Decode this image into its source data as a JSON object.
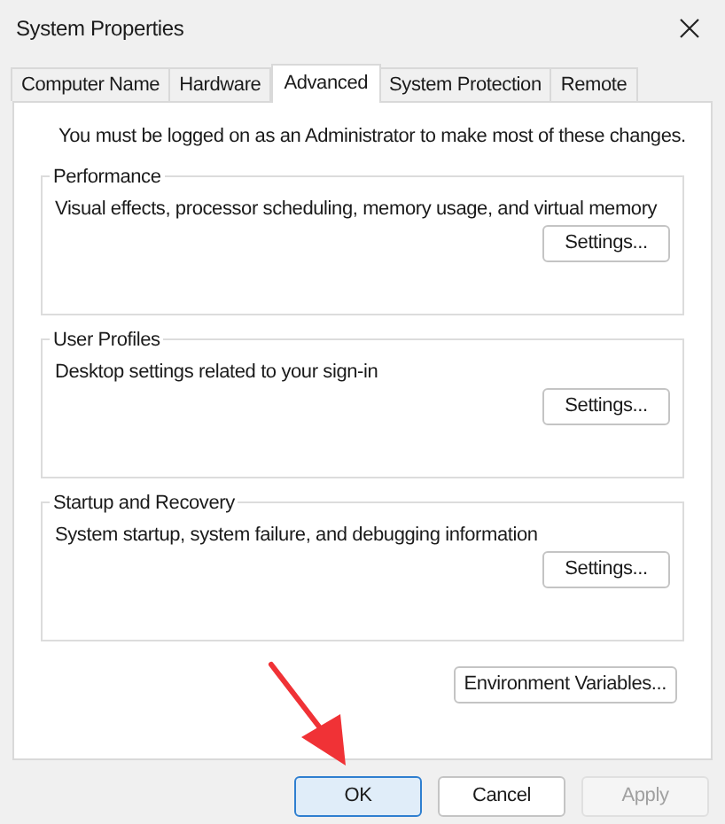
{
  "window": {
    "title": "System Properties"
  },
  "tabs": [
    {
      "label": "Computer Name",
      "selected": false
    },
    {
      "label": "Hardware",
      "selected": false
    },
    {
      "label": "Advanced",
      "selected": true
    },
    {
      "label": "System Protection",
      "selected": false
    },
    {
      "label": "Remote",
      "selected": false
    }
  ],
  "notice": "You must be logged on as an Administrator to make most of these changes.",
  "groups": [
    {
      "title": "Performance",
      "description": "Visual effects, processor scheduling, memory usage, and virtual memory",
      "button": "Settings..."
    },
    {
      "title": "User Profiles",
      "description": "Desktop settings related to your sign-in",
      "button": "Settings..."
    },
    {
      "title": "Startup and Recovery",
      "description": "System startup, system failure, and debugging information",
      "button": "Settings..."
    }
  ],
  "environment_button": "Environment Variables...",
  "buttons": [
    {
      "label": "OK",
      "default": true,
      "disabled": false
    },
    {
      "label": "Cancel",
      "default": false,
      "disabled": false
    },
    {
      "label": "Apply",
      "default": false,
      "disabled": true
    }
  ]
}
